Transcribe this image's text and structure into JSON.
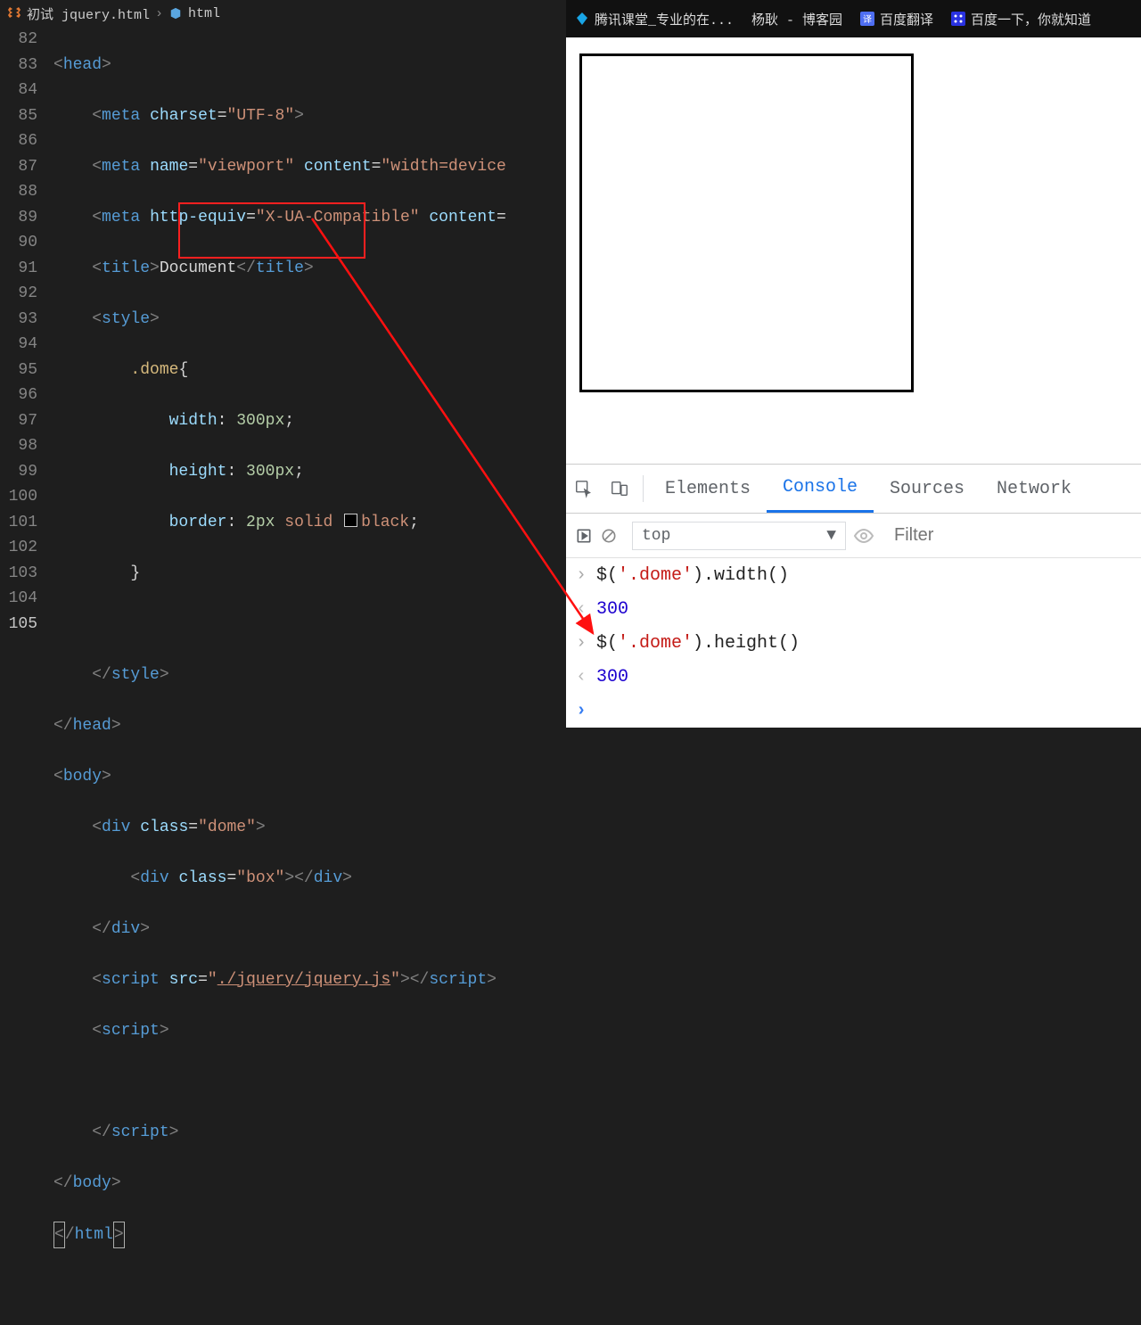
{
  "breadcrumb": {
    "file": "初试 jquery.html",
    "node": "html",
    "file_icon": "orange",
    "node_icon": "blue"
  },
  "lines": [
    82,
    83,
    84,
    85,
    86,
    87,
    88,
    89,
    90,
    91,
    92,
    93,
    94,
    95,
    96,
    97,
    98,
    99,
    100,
    101,
    102,
    103,
    104,
    105
  ],
  "current_line": 105,
  "code": {
    "l82": {
      "tag": "head"
    },
    "l83": {
      "tag": "meta",
      "attr": "charset",
      "val": "UTF-8"
    },
    "l84": {
      "tag": "meta",
      "attr1": "name",
      "val1": "viewport",
      "attr2": "content",
      "val2": "width=device"
    },
    "l85": {
      "tag": "meta",
      "attr1": "http-equiv",
      "val1": "X-UA-Compatible",
      "attr2": "content"
    },
    "l86": {
      "open": "title",
      "text": "Document",
      "close": "title"
    },
    "l87": {
      "tag": "style"
    },
    "l88": {
      "sel": ".dome",
      "brace": "{"
    },
    "l89": {
      "prop": "width",
      "val": "300px"
    },
    "l90": {
      "prop": "height",
      "val": "300px"
    },
    "l91": {
      "prop": "border",
      "val_a": "2px",
      "val_b": "solid",
      "val_c": "black"
    },
    "l92": {
      "brace": "}"
    },
    "l94": {
      "close": "style"
    },
    "l95": {
      "close": "head"
    },
    "l96": {
      "open": "body"
    },
    "l97": {
      "tag": "div",
      "attr": "class",
      "val": "dome"
    },
    "l98": {
      "tag": "div",
      "attr": "class",
      "val": "box",
      "close": "div"
    },
    "l99": {
      "close": "div"
    },
    "l100": {
      "tag": "script",
      "attr": "src",
      "val": "./jquery/jquery.js",
      "close": "script"
    },
    "l101": {
      "tag": "script"
    },
    "l103": {
      "close": "script"
    },
    "l104": {
      "close": "body"
    },
    "l105": {
      "close": "html"
    }
  },
  "browser_tabs": [
    {
      "icon": "blue-diamond",
      "label": "腾讯课堂_专业的在..."
    },
    {
      "icon": "none",
      "label": "杨耿 - 博客园"
    },
    {
      "icon": "baidu-fanyi",
      "label": "百度翻译"
    },
    {
      "icon": "baidu",
      "label": "百度一下，你就知道"
    }
  ],
  "devtools": {
    "tabs": [
      "Elements",
      "Console",
      "Sources",
      "Network"
    ],
    "active": "Console",
    "context": "top",
    "filter_placeholder": "Filter"
  },
  "console": [
    {
      "kind": "in",
      "text_pre": "$(",
      "str": "'.dome'",
      "text_post": ").width()"
    },
    {
      "kind": "out",
      "num": "300"
    },
    {
      "kind": "in",
      "text_pre": "$(",
      "str": "'.dome'",
      "text_post": ").height()"
    },
    {
      "kind": "out",
      "num": "300"
    },
    {
      "kind": "prompt"
    }
  ]
}
